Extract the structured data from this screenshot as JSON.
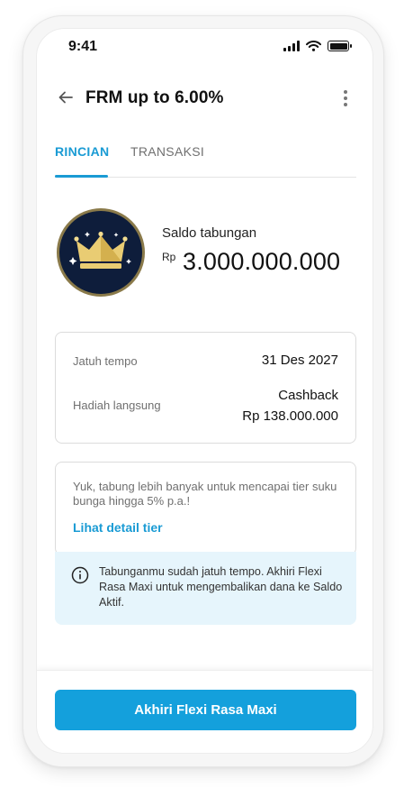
{
  "status_bar": {
    "time": "9:41"
  },
  "header": {
    "title": "FRM up to 6.00%"
  },
  "tabs": [
    {
      "label": "RINCIAN",
      "active": true
    },
    {
      "label": "TRANSAKSI",
      "active": false
    }
  ],
  "balance": {
    "label": "Saldo tabungan",
    "currency": "Rp",
    "value": "3.000.000.000",
    "badge_icon": "crown-icon"
  },
  "details": {
    "maturity_label": "Jatuh tempo",
    "maturity_value": "31 Des 2027",
    "reward_label": "Hadiah langsung",
    "reward_type": "Cashback",
    "reward_amount": "Rp 138.000.000"
  },
  "promo": {
    "text": "Yuk, tabung lebih banyak untuk mencapai tier suku bunga hingga 5% p.a.!",
    "link": "Lihat detail tier"
  },
  "notice": {
    "icon": "info-icon",
    "text": "Tabunganmu sudah jatuh tempo. Akhiri Flexi Rasa Maxi untuk mengembalikan dana ke Saldo Aktif."
  },
  "action": {
    "button_label": "Akhiri Flexi Rasa Maxi"
  },
  "colors": {
    "accent": "#1a9bd4",
    "button": "#14a0dc",
    "notice_bg": "#e6f5fc",
    "badge_bg": "#0e1d3b",
    "crown_gold": "#e9cc73"
  }
}
